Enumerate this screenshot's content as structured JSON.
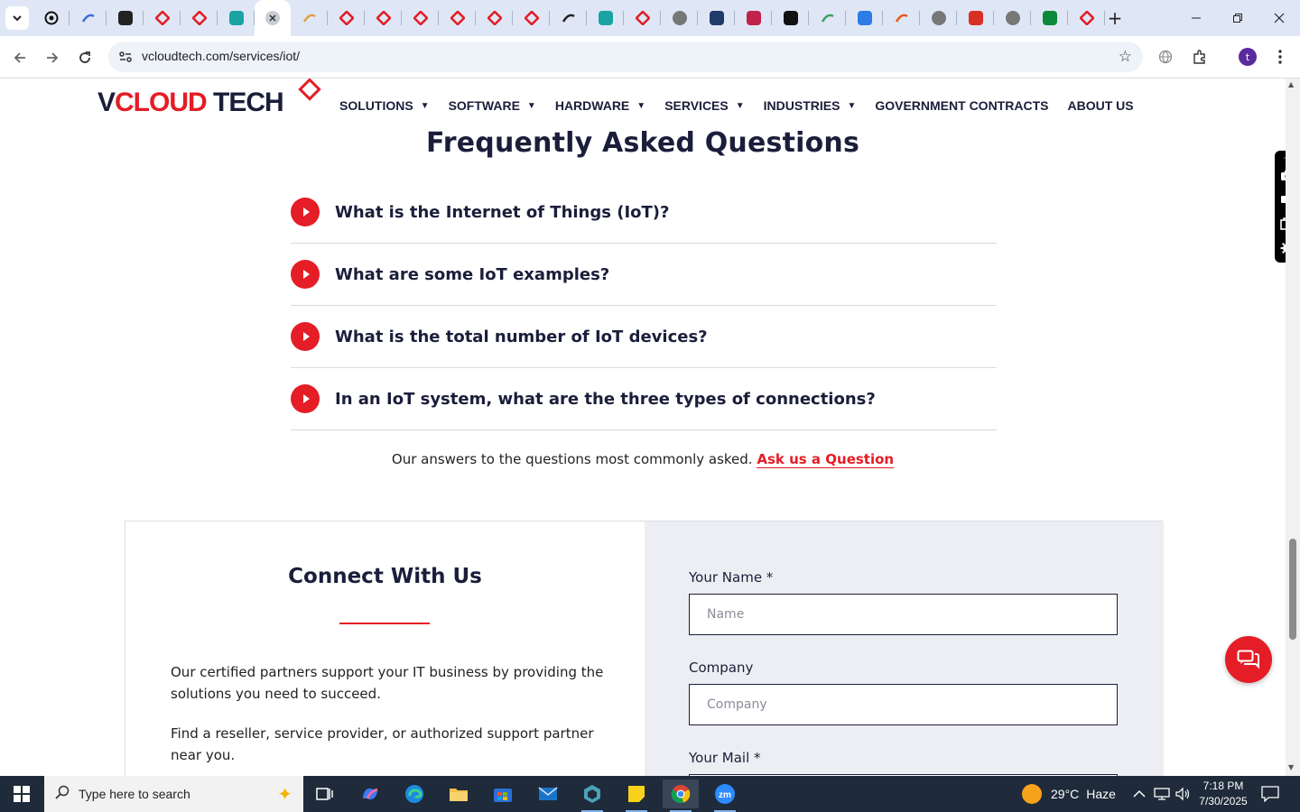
{
  "browser": {
    "url": "vcloudtech.com/services/iot/",
    "profile_initial": "t",
    "tabs": [
      {
        "icon": "circle-icon",
        "color": "#111111"
      },
      {
        "icon": "wifi-icon",
        "color": "#3b6ed8"
      },
      {
        "icon": "openai-icon",
        "color": "#222222"
      },
      {
        "icon": "vcloud-icon",
        "color": "#e41d26"
      },
      {
        "icon": "vcloud-icon",
        "color": "#e41d26"
      },
      {
        "icon": "hex-icon",
        "color": "#1aa3a3"
      },
      {
        "icon": "close-icon",
        "color": "#444444",
        "active": true
      },
      {
        "icon": "hand-icon",
        "color": "#e0a040"
      },
      {
        "icon": "vcloud-icon",
        "color": "#e41d26"
      },
      {
        "icon": "vcloud-icon",
        "color": "#e41d26"
      },
      {
        "icon": "vcloud-icon",
        "color": "#e41d26"
      },
      {
        "icon": "vcloud-icon",
        "color": "#e41d26"
      },
      {
        "icon": "vcloud-icon",
        "color": "#e41d26"
      },
      {
        "icon": "vcloud-icon",
        "color": "#e41d26"
      },
      {
        "icon": "check-icon",
        "color": "#222222"
      },
      {
        "icon": "hex-icon",
        "color": "#1aa3a3"
      },
      {
        "icon": "vcloud-icon",
        "color": "#e41d26"
      },
      {
        "icon": "globe-icon",
        "color": "#777777"
      },
      {
        "icon": "flag-icon",
        "color": "#203a6a"
      },
      {
        "icon": "pill-icon",
        "color": "#c0224a"
      },
      {
        "icon": "x-icon",
        "color": "#111111"
      },
      {
        "icon": "pen-icon",
        "color": "#3fa15a"
      },
      {
        "icon": "wave-icon",
        "color": "#2d7be5"
      },
      {
        "icon": "slash-icon",
        "color": "#e8581c"
      },
      {
        "icon": "globe-icon",
        "color": "#777777"
      },
      {
        "icon": "gmail-icon",
        "color": "#d93025"
      },
      {
        "icon": "globe-icon",
        "color": "#777777"
      },
      {
        "icon": "d-icon",
        "color": "#0b8a3a"
      },
      {
        "icon": "vcloud-icon",
        "color": "#e41d26"
      }
    ],
    "new_tab": "+"
  },
  "site": {
    "logo_v": "V",
    "logo_cloud": "CLOUD",
    "logo_tech": " TECH",
    "nav": [
      {
        "label": "SOLUTIONS",
        "dropdown": true
      },
      {
        "label": "SOFTWARE",
        "dropdown": true
      },
      {
        "label": "HARDWARE",
        "dropdown": true
      },
      {
        "label": "SERVICES",
        "dropdown": true
      },
      {
        "label": "INDUSTRIES",
        "dropdown": true
      },
      {
        "label": "GOVERNMENT CONTRACTS",
        "dropdown": false
      },
      {
        "label": "ABOUT US",
        "dropdown": false
      }
    ]
  },
  "faq": {
    "title": "Frequently Asked Questions",
    "questions": [
      "What is the Internet of Things (IoT)?",
      "What are some IoT examples?",
      "What is the total number of IoT devices?",
      "In an IoT system, what are the three types of connections?"
    ],
    "note": "Our answers to the questions most commonly asked.",
    "note_link": "Ask us a Question"
  },
  "connect": {
    "title": "Connect With Us",
    "para1": "Our certified partners support your IT business by providing the solutions you need to succeed.",
    "para2": "Find a reseller, service provider, or authorized support partner near you.",
    "name_label": "Your Name *",
    "name_placeholder": "Name",
    "company_label": "Company",
    "company_placeholder": "Company",
    "mail_label": "Your Mail *"
  },
  "taskbar": {
    "search_placeholder": "Type here to search",
    "weather_temp": "29°C",
    "weather_desc": "Haze",
    "time": "7:18 PM",
    "date": "7/30/2025"
  },
  "colors": {
    "brand_red": "#e41d26",
    "brand_navy": "#1b1e3a"
  }
}
